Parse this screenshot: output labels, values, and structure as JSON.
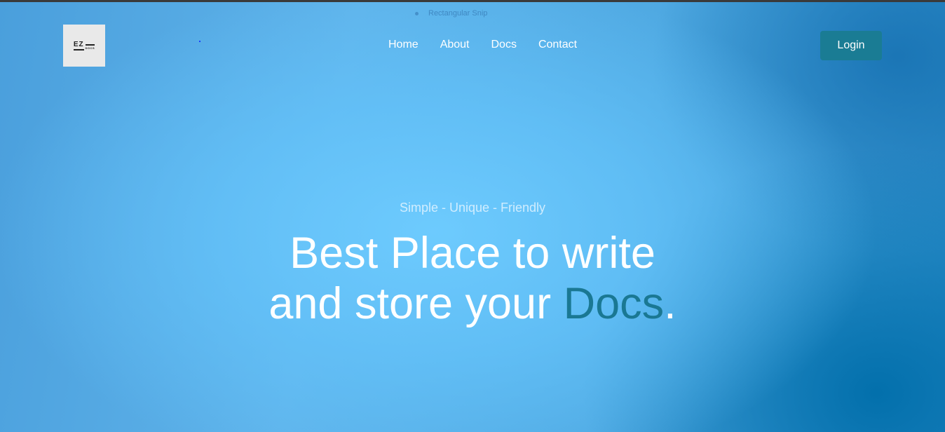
{
  "overlay": {
    "snip_label": "Rectangular Snip"
  },
  "brand": {
    "logo_text_main": "EZ",
    "logo_text_sub": "DOCS"
  },
  "nav": {
    "items": [
      {
        "label": "Home"
      },
      {
        "label": "About"
      },
      {
        "label": "Docs"
      },
      {
        "label": "Contact"
      }
    ]
  },
  "header": {
    "login_label": "Login"
  },
  "hero": {
    "tagline": "Simple - Unique - Friendly",
    "headline_line1": "Best Place to write",
    "headline_line2_prefix": "and store your ",
    "headline_accent": "Docs",
    "headline_suffix": "."
  },
  "colors": {
    "accent": "#1a7893",
    "login_bg": "#1a7c94",
    "text": "#ffffff"
  }
}
